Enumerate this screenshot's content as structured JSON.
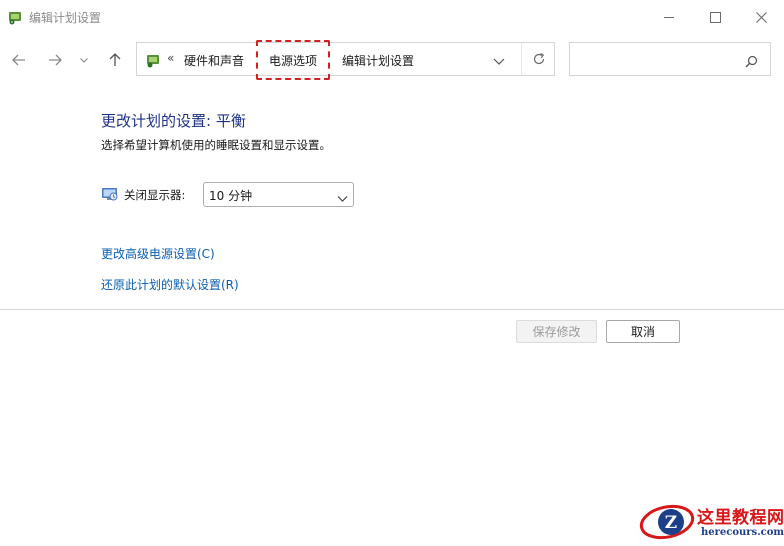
{
  "window": {
    "title": "编辑计划设置"
  },
  "address_bar": {
    "overflow": "«",
    "breadcrumbs": [
      "硬件和声音",
      "电源选项",
      "编辑计划设置"
    ]
  },
  "search": {
    "placeholder": ""
  },
  "content": {
    "heading": "更改计划的设置: 平衡",
    "description": "选择希望计算机使用的睡眠设置和显示设置。",
    "display_off": {
      "label": "关闭显示器:",
      "value": "10 分钟"
    },
    "links": {
      "advanced": "更改高级电源设置(C)",
      "restore": "还原此计划的默认设置(R)"
    }
  },
  "buttons": {
    "save": "保存修改",
    "cancel": "取消"
  },
  "watermark": {
    "text_cn": "这里教程网",
    "text_url": "herecours.com",
    "logo_letter": "Z"
  },
  "colors": {
    "heading": "#1e3287",
    "link": "#0b5fb0",
    "highlight": "#d32020"
  }
}
